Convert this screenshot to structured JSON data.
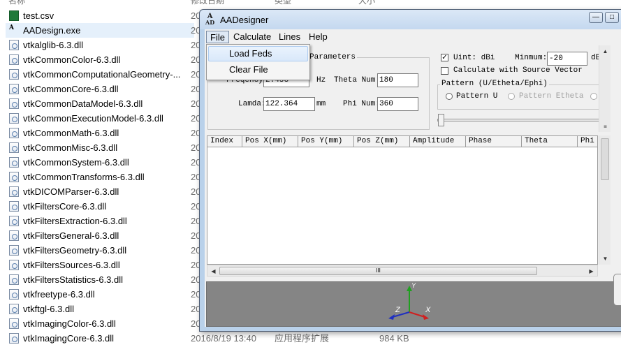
{
  "explorer": {
    "columns": {
      "name": "名称",
      "date": "修改日期",
      "type": "类型",
      "size": "大小"
    },
    "files": [
      {
        "name": "test.csv",
        "icon": "csv-icon"
      },
      {
        "name": "AADesign.exe",
        "icon": "exe-icon",
        "selected": true
      },
      {
        "name": "vtkalglib-6.3.dll"
      },
      {
        "name": "vtkCommonColor-6.3.dll"
      },
      {
        "name": "vtkCommonComputationalGeometry-..."
      },
      {
        "name": "vtkCommonCore-6.3.dll"
      },
      {
        "name": "vtkCommonDataModel-6.3.dll"
      },
      {
        "name": "vtkCommonExecutionModel-6.3.dll"
      },
      {
        "name": "vtkCommonMath-6.3.dll"
      },
      {
        "name": "vtkCommonMisc-6.3.dll"
      },
      {
        "name": "vtkCommonSystem-6.3.dll"
      },
      {
        "name": "vtkCommonTransforms-6.3.dll"
      },
      {
        "name": "vtkDICOMParser-6.3.dll"
      },
      {
        "name": "vtkFiltersCore-6.3.dll"
      },
      {
        "name": "vtkFiltersExtraction-6.3.dll"
      },
      {
        "name": "vtkFiltersGeneral-6.3.dll"
      },
      {
        "name": "vtkFiltersGeometry-6.3.dll"
      },
      {
        "name": "vtkFiltersSources-6.3.dll"
      },
      {
        "name": "vtkFiltersStatistics-6.3.dll"
      },
      {
        "name": "vtkfreetype-6.3.dll"
      },
      {
        "name": "vtkftgl-6.3.dll"
      },
      {
        "name": "vtkImagingColor-6.3.dll"
      },
      {
        "name": "vtkImagingCore-6.3.dll",
        "date": "2016/8/19 13:40",
        "type": "应用程序扩展",
        "size": "984 KB"
      }
    ],
    "date_prefix": "20"
  },
  "window": {
    "title": "AADesigner",
    "app_icon_top": "A",
    "app_icon_bottom": "AD",
    "minimize": "—",
    "maximize": "□"
  },
  "menu": {
    "file": "File",
    "calculate": "Calculate",
    "lines": "Lines",
    "help": "Help",
    "file_items": [
      "Load Feds",
      "Clear File"
    ]
  },
  "params": {
    "group_title": "Parameters",
    "frequency_label": "Freqency:",
    "frequency_value": "2.45G",
    "frequency_unit": "Hz",
    "lamda_label": "Lamda:",
    "lamda_value": "122.364",
    "lamda_unit": "mm",
    "theta_label": "Theta Num:",
    "theta_value": "180",
    "phi_label": "Phi Num:",
    "phi_value": "360"
  },
  "options": {
    "unit_label": "Uint: dBi",
    "unit_checked": true,
    "minimum_label": "Minmum:",
    "minimum_value": "-20",
    "minimum_unit": "dB",
    "calc_source_label": "Calculate with Source Vector",
    "calc_source_checked": false,
    "pattern_group": "Pattern (U/Etheta/Ephi)",
    "pattern_u": "Pattern U",
    "pattern_etheta": "Pattern Etheta"
  },
  "table": {
    "columns": [
      "Index",
      "Pos X(mm)",
      "Pos Y(mm)",
      "Pos Z(mm)",
      "Amplitude",
      "Phase",
      "Theta",
      "Phi"
    ]
  },
  "scroll": {
    "hthumb_mark": "III"
  },
  "axes": {
    "x": "X",
    "y": "Y",
    "z": "Z"
  },
  "colors": {
    "x_axis": "#d02020",
    "y_axis": "#20a020",
    "z_axis": "#2030c0"
  }
}
